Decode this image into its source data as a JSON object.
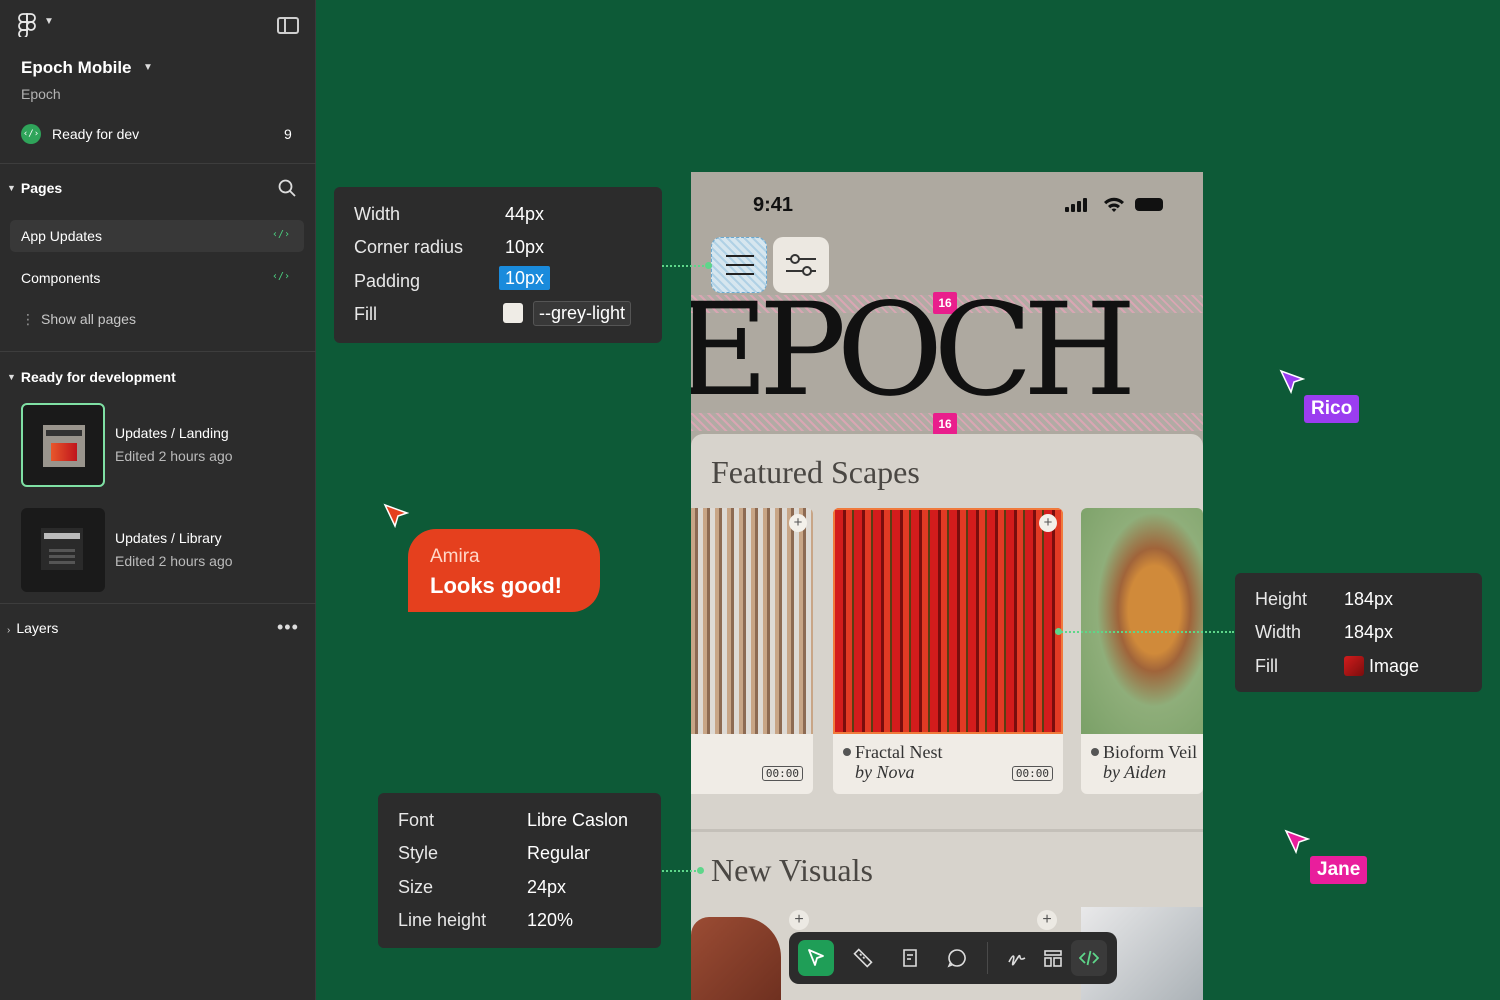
{
  "sidebar": {
    "file_name": "Epoch Mobile",
    "project": "Epoch",
    "dev_status": {
      "label": "Ready for dev",
      "count": "9",
      "icon": "code-icon"
    },
    "pages_header": "Pages",
    "pages": [
      {
        "label": "App Updates",
        "active": true,
        "badge": "‹/›"
      },
      {
        "label": "Components",
        "active": false,
        "badge": "‹/›"
      }
    ],
    "show_all": "Show all pages",
    "ready_header": "Ready for development",
    "ready_items": [
      {
        "title": "Updates / Landing",
        "meta": "Edited 2 hours ago"
      },
      {
        "title": "Updates / Library",
        "meta": "Edited 2 hours ago"
      }
    ],
    "layers_header": "Layers"
  },
  "phone": {
    "time": "9:41",
    "wordmark": "EPOCH",
    "spacing_tag_top": "16",
    "spacing_tag_bottom": "16",
    "featured_title": "Featured Scapes",
    "cards": [
      {
        "name": "",
        "author": "",
        "duration": "00:00"
      },
      {
        "name": "Fractal Nest",
        "author": "by Nova",
        "duration": "00:00"
      },
      {
        "name": "Bioform Veil",
        "author": "by Aiden",
        "duration": ""
      }
    ],
    "new_visuals_title": "New Visuals"
  },
  "spec_button": {
    "rows": [
      {
        "label": "Width",
        "value": "44px"
      },
      {
        "label": "Corner radius",
        "value": "10px"
      },
      {
        "label": "Padding",
        "value": "10px"
      },
      {
        "label": "Fill",
        "value": "--grey-light"
      }
    ],
    "fill_color": "#efece6"
  },
  "spec_image": {
    "rows": [
      {
        "label": "Height",
        "value": "184px"
      },
      {
        "label": "Width",
        "value": "184px"
      },
      {
        "label": "Fill",
        "value": "Image"
      }
    ]
  },
  "spec_font": {
    "rows": [
      {
        "label": "Font",
        "value": "Libre Caslon"
      },
      {
        "label": "Style",
        "value": "Regular"
      },
      {
        "label": "Size",
        "value": "24px"
      },
      {
        "label": "Line height",
        "value": "120%"
      }
    ]
  },
  "comment": {
    "author": "Amira",
    "message": "Looks good!",
    "color": "#e5401e"
  },
  "cursors": [
    {
      "name": "Rico",
      "color": "#9b3df0"
    },
    {
      "name": "Jane",
      "color": "#e91e9c"
    }
  ],
  "toolbar": {
    "tools": [
      "move-icon",
      "ruler-icon",
      "annotate-icon",
      "comment-icon",
      "draw-icon",
      "components-icon",
      "dev-mode-icon"
    ]
  },
  "colors": {
    "canvas": "#0d5a37",
    "panel": "#2c2c2c",
    "accent_green": "#1f9e57",
    "spacing_pink": "#e91e8c"
  }
}
